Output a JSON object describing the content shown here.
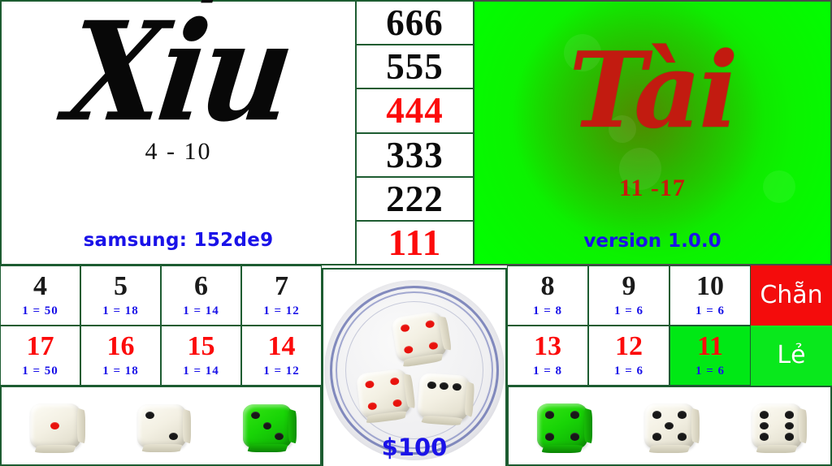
{
  "left_panel": {
    "logo_text": "Xỉu",
    "range": "4 - 10",
    "device_label": "samsung: 152de9"
  },
  "numbers_column": {
    "cells": [
      {
        "value": "666",
        "color": "black"
      },
      {
        "value": "555",
        "color": "black"
      },
      {
        "value": "444",
        "color": "red"
      },
      {
        "value": "333",
        "color": "black"
      },
      {
        "value": "222",
        "color": "black"
      },
      {
        "value": "111",
        "color": "red"
      }
    ]
  },
  "right_panel": {
    "logo_text": "Tài",
    "range": "11 -17",
    "version_label": "version 1.0.0"
  },
  "bet_grid": {
    "left": {
      "top_row": [
        {
          "number": "4",
          "odds": "1 = 50"
        },
        {
          "number": "5",
          "odds": "1 = 18"
        },
        {
          "number": "6",
          "odds": "1 = 14"
        },
        {
          "number": "7",
          "odds": "1 = 12"
        }
      ],
      "bottom_row": [
        {
          "number": "17",
          "odds": "1 = 50"
        },
        {
          "number": "16",
          "odds": "1 = 18"
        },
        {
          "number": "15",
          "odds": "1 = 14"
        },
        {
          "number": "14",
          "odds": "1 = 12"
        }
      ]
    },
    "right": {
      "top_row": [
        {
          "number": "8",
          "odds": "1 = 8"
        },
        {
          "number": "9",
          "odds": "1 = 6"
        },
        {
          "number": "10",
          "odds": "1 = 6"
        }
      ],
      "bottom_row": [
        {
          "number": "13",
          "odds": "1 = 8"
        },
        {
          "number": "12",
          "odds": "1 = 6"
        },
        {
          "number": "11",
          "odds": "1 = 6"
        }
      ],
      "even_label": "Chẵn",
      "odd_label": "Lẻ"
    },
    "selected_number": "11"
  },
  "plate": {
    "amount": "$100",
    "dice": [
      {
        "value": 4,
        "body": "white",
        "pip_color": "red"
      },
      {
        "value": 4,
        "body": "white",
        "pip_color": "red"
      },
      {
        "value": 3,
        "body": "white",
        "pip_color": "black"
      }
    ]
  },
  "dice_strip_left": [
    {
      "value": 1,
      "body": "white",
      "pip_color": "red"
    },
    {
      "value": 2,
      "body": "white",
      "pip_color": "black"
    },
    {
      "value": 3,
      "body": "green",
      "pip_color": "black"
    }
  ],
  "dice_strip_right": [
    {
      "value": 4,
      "body": "green",
      "pip_color": "black"
    },
    {
      "value": 5,
      "body": "white",
      "pip_color": "black"
    },
    {
      "value": 6,
      "body": "white",
      "pip_color": "black"
    }
  ],
  "colors": {
    "border_green": "#1d5c31",
    "accent_red": "#fc0b0b",
    "accent_blue": "#1a12e8",
    "panel_green": "#00ff00",
    "selected_green": "#00e815",
    "even_red": "#f40c0c",
    "odd_green": "#09e81c"
  }
}
